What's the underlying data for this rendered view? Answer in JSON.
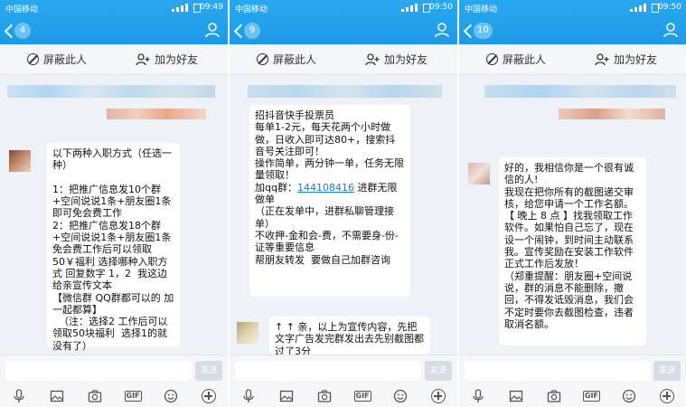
{
  "panels": [
    {
      "carrier": "中国移动",
      "time": "09:49",
      "back_count": "4",
      "block_label": "屏蔽此人",
      "add_friend_label": "加为好友",
      "message": "以下两种入职方式（任选一种）\n\n1：把推广信息发10个群+空间说说1条+朋友圈1条 即可免会费工作\n2：把推广信息发18个群+空间说说1条+朋友圈1条 免会费工作后可以领取50￥福利 选择哪种入职方式 回复数字 1，2  我这边给亲宣传文本\n【微信群 QQ群都可以的 加一起都算】\n  （注：选择2 工作后可以领取50块福利  选择1的就没有了）",
      "send_label": "发送"
    },
    {
      "carrier": "中国移动",
      "time": "09:50",
      "back_count": "9",
      "block_label": "屏蔽此人",
      "add_friend_label": "加为好友",
      "message_before_link": "招抖音快手投票员\n每单1-2元，每天花两个小时做做，日收入即可达80+，搜索抖音号关注即可！\n操作简单，两分钟一单，任务无限量领取！\n加qq群：",
      "link_text": "144108416",
      "message_after_link": " 进群无限做单\n（正在发单中，进群私聊管理接单）\n不收押-金和会-费，不需要身-份-证等重要信息\n帮朋友转发  要做自己加群咨询",
      "message2": "↑ ↑ 亲，以上为宣传内容，先把文字广告发完群发出去先别截图都过了3分",
      "send_label": "发送"
    },
    {
      "carrier": "中国移动",
      "time": "09:50",
      "back_count": "10",
      "block_label": "屏蔽此人",
      "add_friend_label": "加为好友",
      "message": "好的，我相信你是一个很有诚信的人!\n我现在把你所有的截图递交审核，给您申请一个工作名额。\n【 晚上 8 点 】找我领取工作软件。如果怕自己忘了，现在设一个闹钟，到时间主动联系我。宣传奖励在安装工作软件正式工作后发放！\n（郑重提醒：朋友圈+空间说说，群的消息不能删除，撤回，不得发诋毁消息，我们会不定时要你去截图检查，违者取消名额。",
      "send_label": "发送"
    }
  ],
  "colors": {
    "header": "#1e9be8",
    "link": "#1a7ad4",
    "background": "#eef1f5"
  },
  "icons": [
    "back-chevron-icon",
    "contact-icon",
    "block-icon",
    "add-friend-icon",
    "mic-icon",
    "image-icon",
    "camera-icon",
    "gif-icon",
    "emoji-icon",
    "plus-icon"
  ]
}
